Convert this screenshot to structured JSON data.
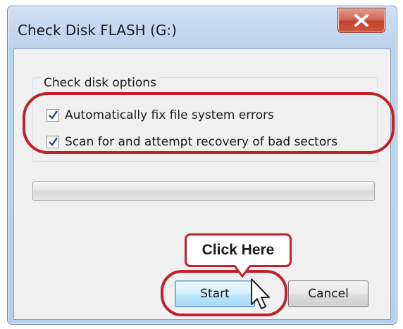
{
  "window": {
    "title": "Check Disk FLASH (G:)",
    "close_icon": "close-icon"
  },
  "options": {
    "group_label": "Check disk options",
    "items": [
      {
        "label": "Automatically fix file system errors",
        "checked": true
      },
      {
        "label": "Scan for and attempt recovery of bad sectors",
        "checked": true
      }
    ]
  },
  "progress": {
    "value": 0
  },
  "buttons": {
    "start_label": "Start",
    "cancel_label": "Cancel"
  },
  "annotation": {
    "callout_text": "Click Here",
    "highlight_color": "#c0212b"
  }
}
